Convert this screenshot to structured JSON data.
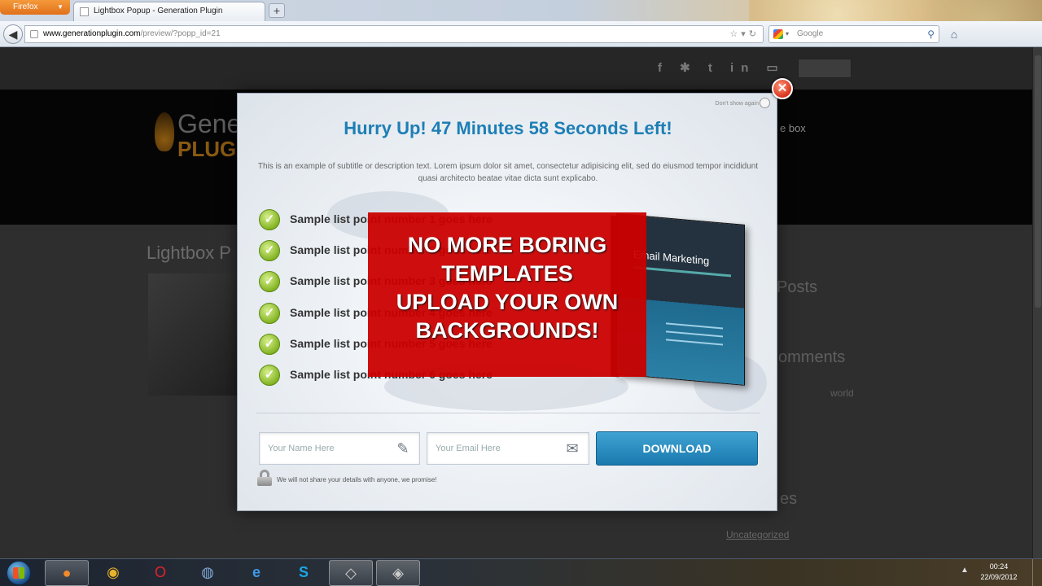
{
  "browser": {
    "menu_button": "Firefox",
    "tab_title": "Lightbox Popup - Generation Plugin",
    "new_tab": "+",
    "url_host": "www.generationplugin.com",
    "url_path": "/preview/?popp_id=21",
    "search_placeholder": "Google"
  },
  "website": {
    "logo_line1": "Gene",
    "logo_line2": "PLUG",
    "header_right": "e box",
    "side_title": "Lightbox P",
    "right_posts": "Posts",
    "right_comments": "omments",
    "right_small": "world",
    "right_extra": "es",
    "footer_link": "Uncategorized"
  },
  "popup": {
    "dont_show": "Don't show again",
    "headline": "Hurry Up! 47 Minutes 58 Seconds Left!",
    "subtitle": "This is an example of subtitle or description text. Lorem ipsum dolor sit amet, consectetur adipisicing elit, sed do eiusmod tempor incididunt quasi architecto beatae vitae dicta sunt explicabo.",
    "list": [
      "Sample list point number 1 goes here",
      "Sample list point number 2 goes here",
      "Sample list point number 3 goes here",
      "Sample list point number 4 goes here",
      "Sample list point number 5 goes here",
      "Sample list point number 6 goes here"
    ],
    "banner": [
      "NO MORE BORING",
      "TEMPLATES",
      "UPLOAD YOUR OWN",
      "BACKGROUNDS!"
    ],
    "book_title": "Email Marketing",
    "name_placeholder": "Your Name Here",
    "email_placeholder": "Your Email Here",
    "download_label": "DOWNLOAD",
    "privacy_note": "We will not share your details with anyone, we promise!"
  },
  "taskbar": {
    "time": "00:24",
    "date": "22/09/2012"
  },
  "colors": {
    "headline": "#1d7eb5",
    "download": "#1f86bd",
    "banner": "#cc0000",
    "check": "#7fb01d",
    "close": "#d8311c"
  }
}
